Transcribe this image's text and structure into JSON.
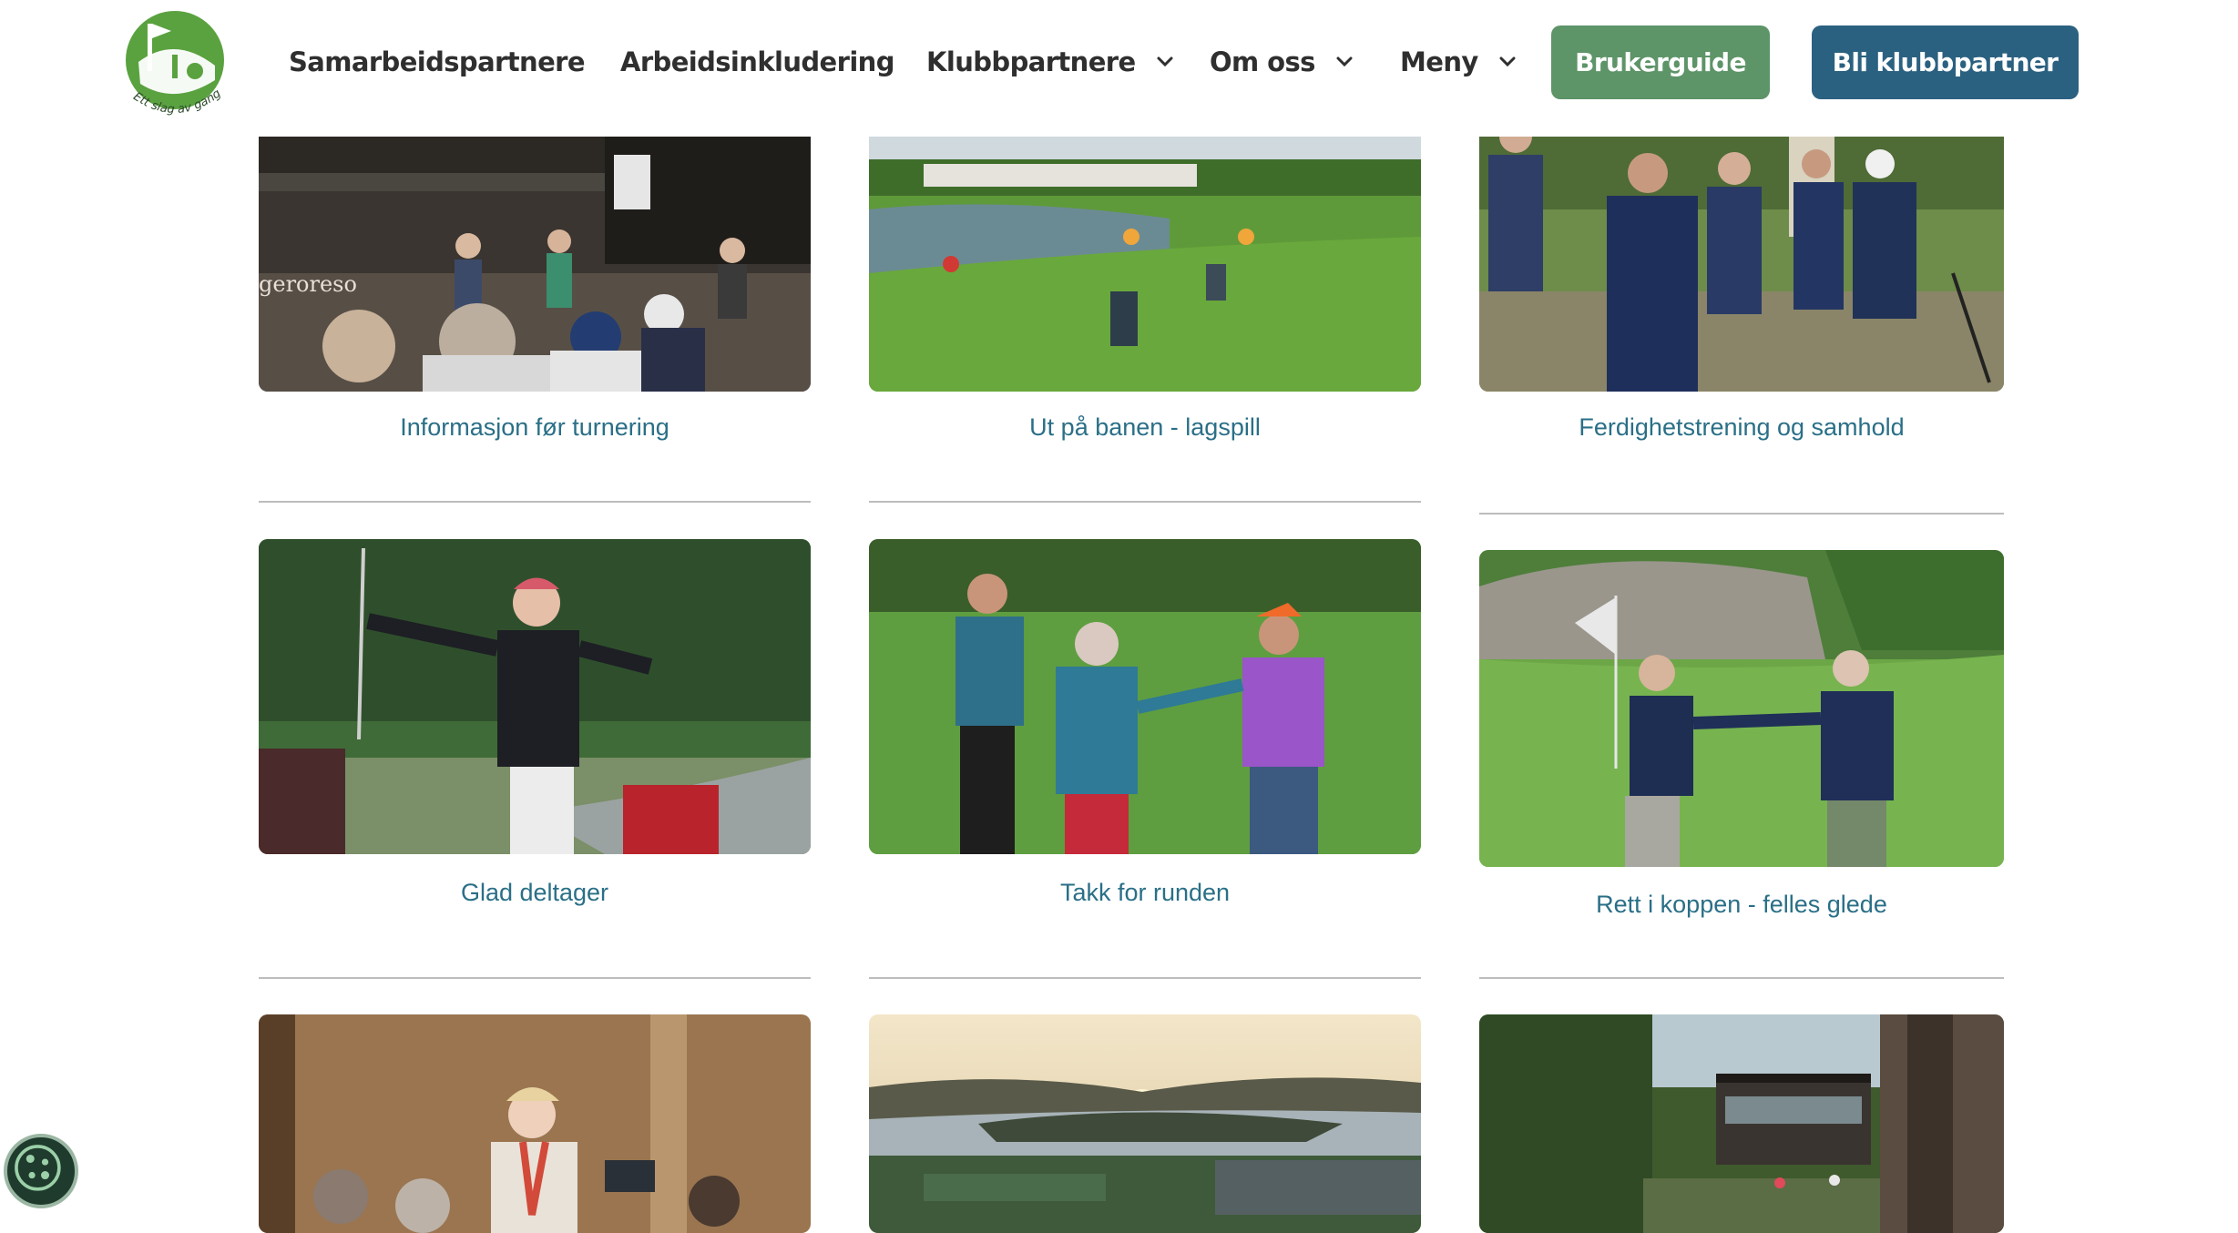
{
  "brand": {
    "name": "Ett slag av gangen",
    "logo_text": "Ett slag av gangen",
    "colors": {
      "green": "#5d9468",
      "blue": "#2b6180",
      "caption": "#2a6f87",
      "logo_green": "#5aa23f"
    }
  },
  "nav": {
    "items": [
      {
        "label": "Samarbeidspartnere",
        "has_dropdown": false
      },
      {
        "label": "Arbeidsinkludering",
        "has_dropdown": false
      },
      {
        "label": "Klubbpartnere",
        "has_dropdown": true
      },
      {
        "label": "Om oss",
        "has_dropdown": true
      },
      {
        "label": "Meny",
        "has_dropdown": true
      }
    ],
    "cta_guide": "Brukerguide",
    "cta_partner": "Bli klubbpartner"
  },
  "gallery": {
    "items": [
      {
        "caption": "Informasjon før turnering",
        "icon": "photo-briefing",
        "overlay_text": "gerorеsо"
      },
      {
        "caption": "Ut på banen - lagspill",
        "icon": "photo-golf-course"
      },
      {
        "caption": "Ferdighetstrening og samhold",
        "icon": "photo-group"
      },
      {
        "caption": "Glad deltager",
        "icon": "photo-happy-golfer"
      },
      {
        "caption": "Takk for runden",
        "icon": "photo-handshake"
      },
      {
        "caption": "Rett i koppen - felles glede",
        "icon": "photo-fistbump"
      },
      {
        "caption": "",
        "icon": "photo-speaker"
      },
      {
        "caption": "",
        "icon": "photo-sunset-fjord"
      },
      {
        "caption": "",
        "icon": "photo-clubhouse"
      }
    ]
  },
  "cookie": {
    "icon": "cookie-icon"
  }
}
